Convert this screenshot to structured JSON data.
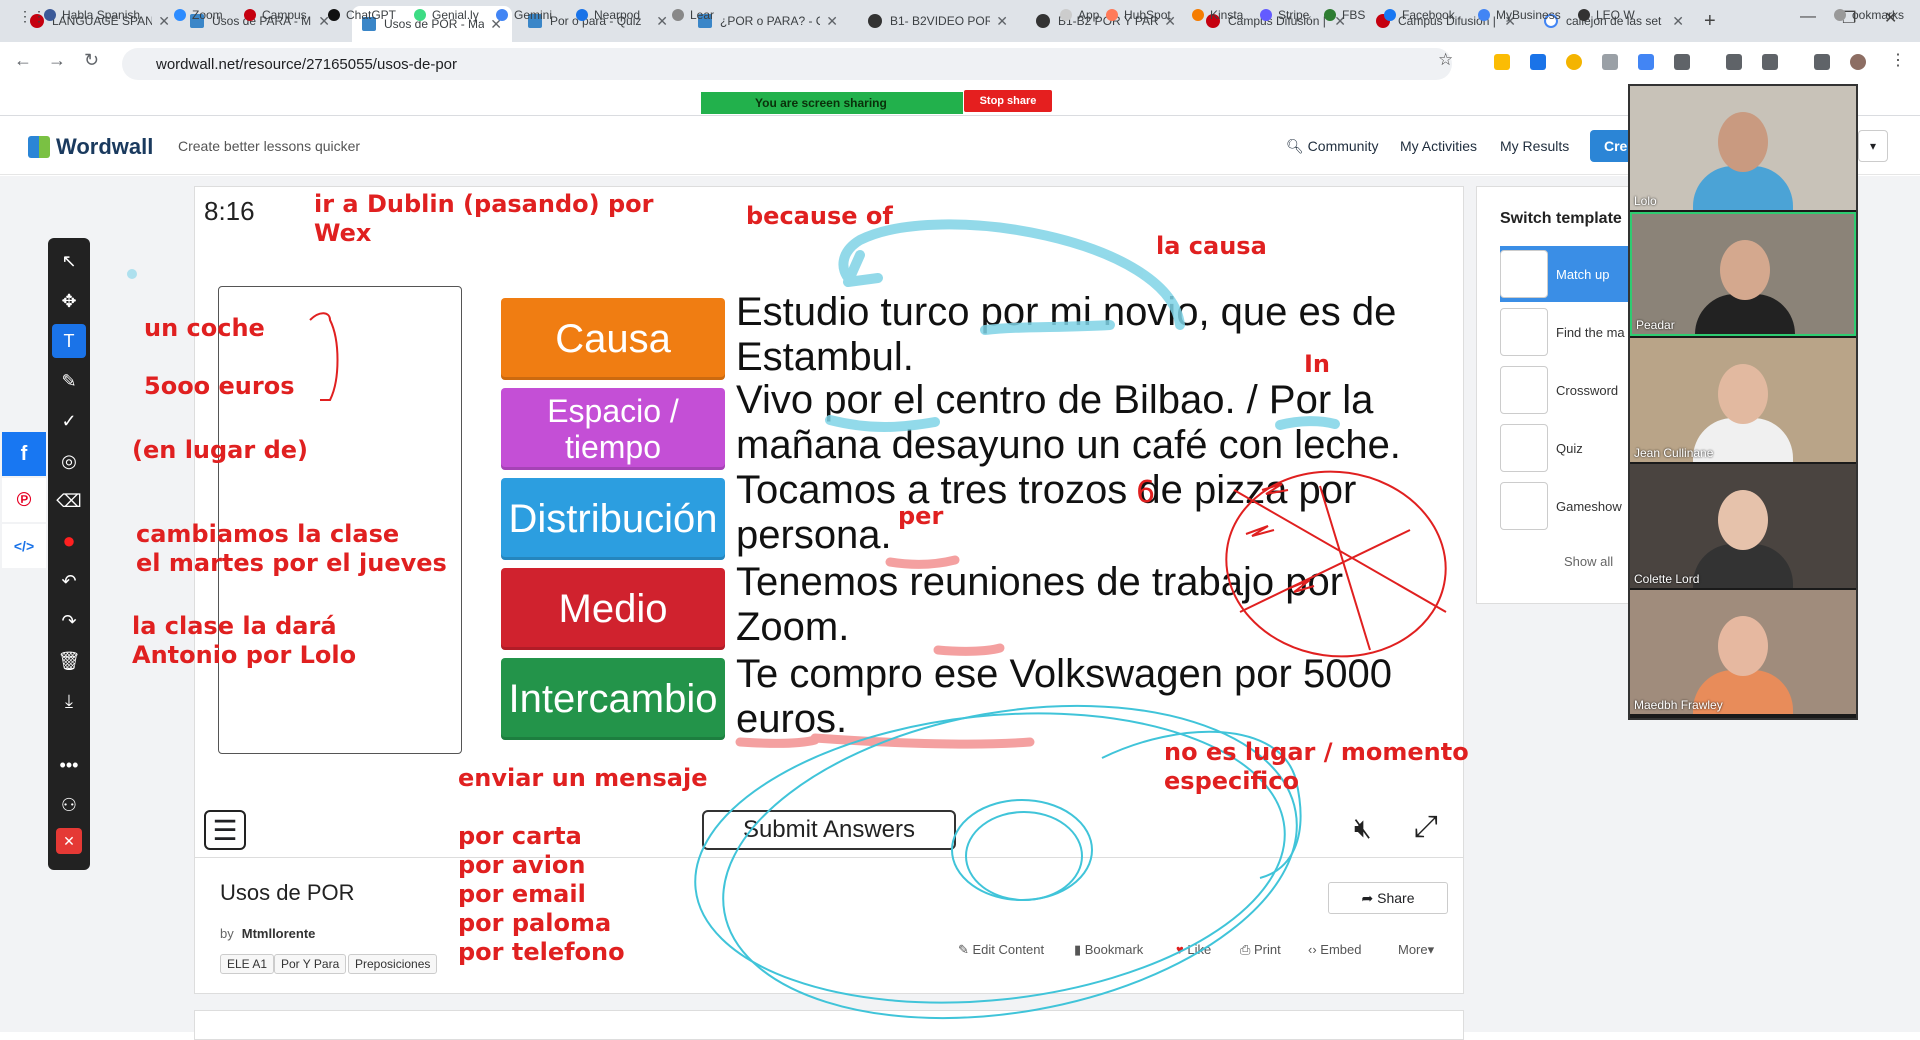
{
  "browser": {
    "tabs": [
      {
        "title": "LANGUAGE SPANI",
        "fav": "red"
      },
      {
        "title": "Usos de PARA - M",
        "fav": "ww"
      },
      {
        "title": "Usos de POR - Ma",
        "fav": "ww",
        "active": true
      },
      {
        "title": "Por o para - Quiz",
        "fav": "ww"
      },
      {
        "title": "¿POR o PARA? - C",
        "fav": "ww"
      },
      {
        "title": "B1- B2VIDEO POR",
        "fav": "g2"
      },
      {
        "title": "B1-B2 POR Y PARA",
        "fav": "g2"
      },
      {
        "title": "Campus Difusión |",
        "fav": "red"
      },
      {
        "title": "Campus Difusión |",
        "fav": "red"
      },
      {
        "title": "callejon de las set",
        "fav": "g"
      }
    ],
    "url": "wordwall.net/resource/27165055/usos-de-por",
    "bookmarks": [
      "Habla Spanish",
      "Zoom",
      "Campus",
      "ChatGPT",
      "Genial.ly",
      "Gemini",
      "Nearpod",
      "Lear",
      "App",
      "HubSpot",
      "Kinsta",
      "Stripe",
      "FBS",
      "Facebook",
      "MyBusiness",
      "LEO W",
      "ookmarks"
    ],
    "screen_share_text": "You are screen sharing",
    "stop_share_label": "Stop share"
  },
  "header": {
    "logo": "Wordwall",
    "tagline": "Create better lessons quicker",
    "nav": [
      "Community",
      "My Activities",
      "My Results"
    ],
    "create_label": "Cre"
  },
  "activity": {
    "timer": "8:16",
    "categories": [
      {
        "label": "Causa",
        "color": "#f07d12"
      },
      {
        "label": "Espacio / tiempo",
        "color": "#c44fd6"
      },
      {
        "label": "Distribución",
        "color": "#2c9ee0"
      },
      {
        "label": "Medio",
        "color": "#d0222e"
      },
      {
        "label": "Intercambio",
        "color": "#23944a"
      }
    ],
    "sentences": [
      "Estudio turco por mi novio, que es de Estambul.",
      "Vivo por el centro de Bilbao. / Por la mañana desayuno un café con leche.",
      "Tocamos a tres trozos de pizza por persona.",
      "Tenemos reuniones de trabajo por Zoom.",
      "Te compro ese Volkswagen por 5000 euros."
    ],
    "submit_label": "Submit Answers"
  },
  "info": {
    "title": "Usos de POR",
    "by_label": "by",
    "author": "Mtmllorente",
    "tags": [
      "ELE A1",
      "Por Y Para",
      "Preposiciones"
    ],
    "share_label": "Share",
    "actions": [
      "Edit Content",
      "Bookmark",
      "Like",
      "Print",
      "Embed",
      "More"
    ]
  },
  "switch_template": {
    "title": "Switch template",
    "items": [
      "Match up",
      "Find the ma",
      "Crossword",
      "Quiz",
      "Gameshow"
    ],
    "show_all": "Show all"
  },
  "participants": [
    "Lolo",
    "Peadar",
    "Jean Cullinane",
    "Colette Lord",
    "Maedbh Frawley"
  ],
  "annotations": {
    "dublin": "ir a Dublin (pasando) por\nWex",
    "because_of": "because of",
    "la_causa": "la causa",
    "in": "In",
    "per": "per",
    "seis": "6",
    "un_coche": "un coche",
    "euros": "5ooo euros",
    "en_lugar": "(en lugar de)",
    "cambiamos": "cambiamos la clase\nel martes por el jueves",
    "antonio": "la clase la dará\nAntonio por Lolo",
    "enviar": "enviar un mensaje",
    "por_list": "por carta\npor avion\npor email\npor paloma\npor telefono",
    "lugar": "no es lugar / momento\nespecifico"
  },
  "colors": {
    "annotation": "#e02020",
    "highlight": "#6fd0e6",
    "ww_blue": "#2b85d6"
  }
}
